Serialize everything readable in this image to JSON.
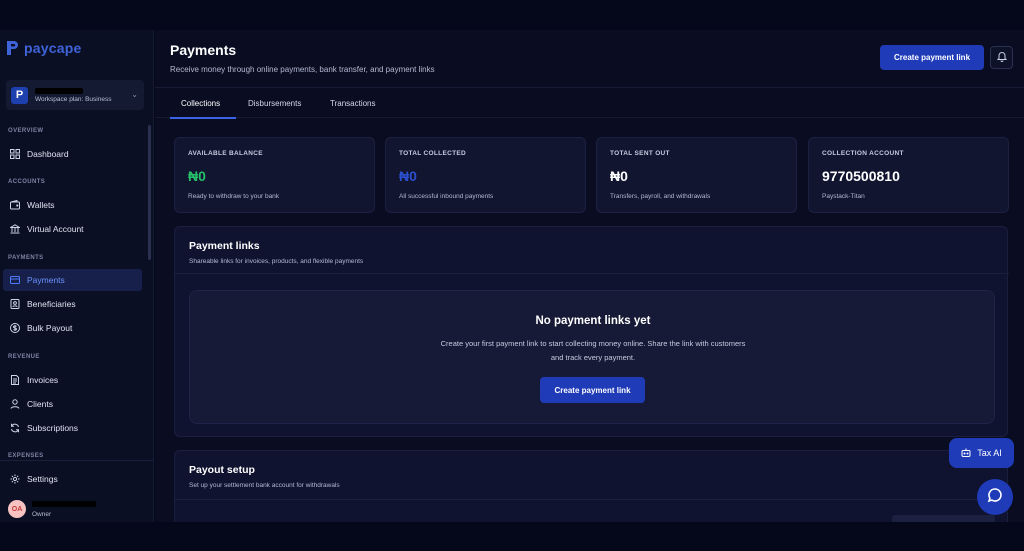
{
  "brand": {
    "name": "paycape",
    "color": "#3f63d8"
  },
  "workspace": {
    "avatar_letter": "P",
    "plan": "Workspace plan: Business"
  },
  "sidebar": {
    "sections": {
      "overview": "OVERVIEW",
      "accounts": "ACCOUNTS",
      "payments": "PAYMENTS",
      "revenue": "REVENUE",
      "expenses": "EXPENSES"
    },
    "items": {
      "dashboard": "Dashboard",
      "wallets": "Wallets",
      "virtual_account": "Virtual Account",
      "payments": "Payments",
      "beneficiaries": "Beneficiaries",
      "bulk_payout": "Bulk Payout",
      "invoices": "Invoices",
      "clients": "Clients",
      "subscriptions": "Subscriptions",
      "settings": "Settings"
    },
    "active_item": "payments"
  },
  "user": {
    "initials": "OA",
    "role": "Owner"
  },
  "header": {
    "title": "Payments",
    "subtitle": "Receive money through online payments, bank transfer, and payment links",
    "create_button": "Create payment link"
  },
  "tabs": [
    {
      "label": "Collections",
      "active": true
    },
    {
      "label": "Disbursements",
      "active": false
    },
    {
      "label": "Transactions",
      "active": false
    }
  ],
  "stats": [
    {
      "label": "AVAILABLE BALANCE",
      "value": "₦0",
      "note": "Ready to withdraw to your bank",
      "color": "#27c06a"
    },
    {
      "label": "TOTAL COLLECTED",
      "value": "₦0",
      "note": "All successful inbound payments",
      "color": "#2c4fd0"
    },
    {
      "label": "TOTAL SENT OUT",
      "value": "₦0",
      "note": "Transfers, payroll, and withdrawals",
      "color": "#ffffff"
    },
    {
      "label": "COLLECTION ACCOUNT",
      "value": "9770500810",
      "note": "Paystack-Titan",
      "color": "#ffffff"
    }
  ],
  "payment_links": {
    "title": "Payment links",
    "subtitle": "Shareable links for invoices, products, and flexible payments",
    "empty_title": "No payment links yet",
    "empty_desc": "Create your first payment link to start collecting money online. Share the link with customers and track every payment.",
    "empty_button": "Create payment link"
  },
  "payout_setup": {
    "title": "Payout setup",
    "subtitle": "Set up your settlement bank account for withdrawals"
  },
  "floating": {
    "tax_ai": "Tax AI"
  },
  "colors": {
    "accent": "#1f3bb8",
    "active_link": "#6d92ff"
  }
}
